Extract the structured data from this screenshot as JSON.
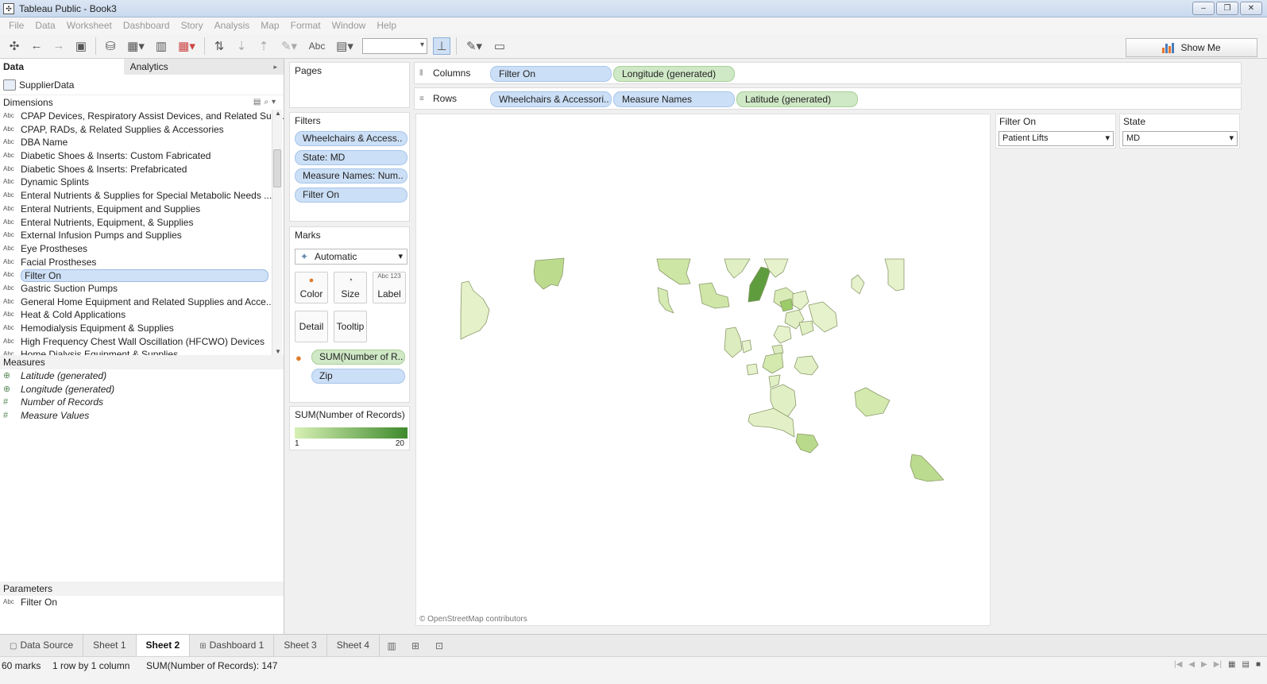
{
  "window": {
    "title": "Tableau Public - Book3",
    "controls": [
      "–",
      "❐",
      "✕"
    ]
  },
  "menu": [
    "File",
    "Data",
    "Worksheet",
    "Dashboard",
    "Story",
    "Analysis",
    "Map",
    "Format",
    "Window",
    "Help"
  ],
  "toolbar": {
    "label_text": "Abc",
    "show_me": "Show Me"
  },
  "datapane": {
    "tab_data": "Data",
    "tab_analytics": "Analytics",
    "source": "SupplierData",
    "dimensions_header": "Dimensions",
    "type_abc": "Abc",
    "dimensions": [
      "CPAP Devices, Respiratory Assist Devices, and Related Sup...",
      "CPAP, RADs, & Related Supplies & Accessories",
      "DBA Name",
      "Diabetic Shoes & Inserts: Custom Fabricated",
      "Diabetic Shoes & Inserts: Prefabricated",
      "Dynamic Splints",
      "Enteral Nutrients & Supplies for Special Metabolic Needs ...",
      "Enteral Nutrients, Equipment and Supplies",
      "Enteral Nutrients, Equipment, & Supplies",
      "External Infusion Pumps and Supplies",
      "Eye Prostheses",
      "Facial Prostheses",
      "Filter On",
      "Gastric Suction Pumps",
      "General Home Equipment and Related Supplies and Acce...",
      "Heat & Cold Applications",
      "Hemodialysis Equipment & Supplies",
      "High Frequency Chest Wall Oscillation (HFCWO) Devices",
      "Home Dialysis Equipment & Supplies"
    ],
    "measures_header": "Measures",
    "measures": [
      "Latitude (generated)",
      "Longitude (generated)",
      "Number of Records",
      "Measure Values"
    ],
    "parameters_header": "Parameters",
    "parameters": [
      "Filter On"
    ]
  },
  "pages": {
    "title": "Pages"
  },
  "filters": {
    "title": "Filters",
    "items": [
      "Wheelchairs & Access..",
      "State: MD",
      "Measure Names: Num..",
      "Filter On"
    ]
  },
  "marks": {
    "title": "Marks",
    "type": "Automatic",
    "buttons": {
      "color": "Color",
      "size": "Size",
      "label": "Label",
      "detail": "Detail",
      "tooltip": "Tooltip",
      "label_icon": "Abc 123"
    },
    "fields": [
      "SUM(Number of R..",
      "Zip"
    ]
  },
  "legend": {
    "title": "SUM(Number of Records)",
    "min": "1",
    "max": "20",
    "color_low": "#d7f0b4",
    "color_high": "#3e8a2c"
  },
  "shelves": {
    "columns_label": "Columns",
    "columns": [
      "Filter On",
      "Longitude (generated)"
    ],
    "rows_label": "Rows",
    "rows": [
      "Wheelchairs & Accessori..",
      "Measure Names",
      "Latitude (generated)"
    ]
  },
  "view": {
    "attribution": "© OpenStreetMap contributors"
  },
  "quick_filters": [
    {
      "title": "Filter On",
      "value": "Patient Lifts"
    },
    {
      "title": "State",
      "value": "MD"
    }
  ],
  "sheet_tabs": [
    "Data Source",
    "Sheet 1",
    "Sheet 2",
    "Dashboard 1",
    "Sheet 3",
    "Sheet 4"
  ],
  "active_tab": "Sheet 2",
  "status": {
    "marks": "60 marks",
    "dims": "1 row by 1 column",
    "sum": "SUM(Number of Records): 147"
  }
}
